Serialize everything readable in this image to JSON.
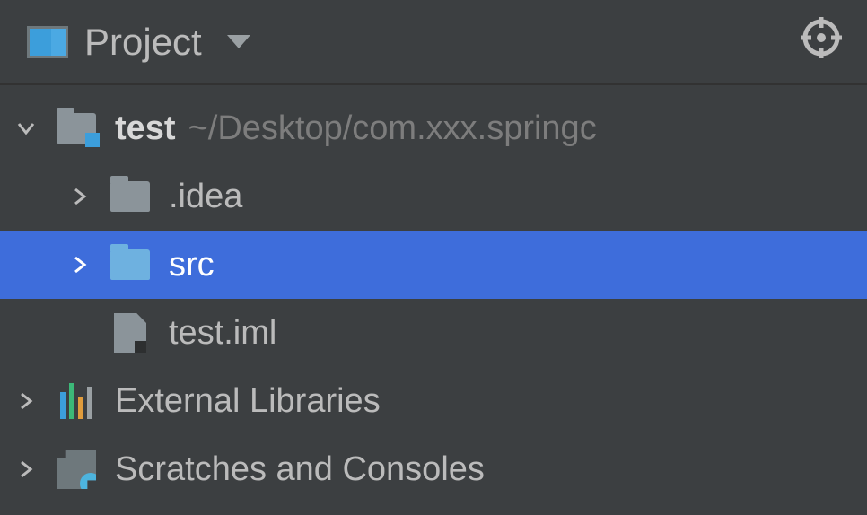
{
  "header": {
    "title": "Project"
  },
  "tree": {
    "root": {
      "name": "test",
      "path": "~/Desktop/com.xxx.springc",
      "children": {
        "idea": ".idea",
        "src": "src",
        "iml": "test.iml"
      }
    },
    "external": "External Libraries",
    "scratches": "Scratches and Consoles"
  }
}
